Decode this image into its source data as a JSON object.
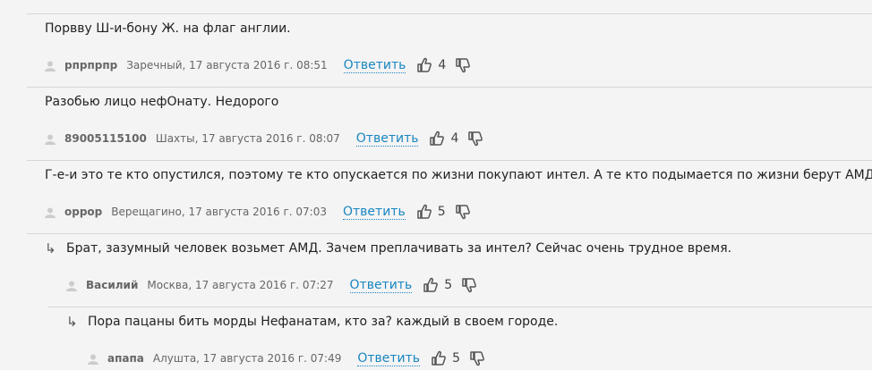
{
  "comments": [
    {
      "text": "Порвву Ш-и-бону Ж. на флаг англии.",
      "author": "рпрпрпр",
      "location_date": "Заречный, 17 августа 2016 г. 08:51",
      "reply_label": "Ответить",
      "score": "4"
    },
    {
      "text": "Разобью лицо нефОнату. Недорого",
      "author": "89005115100",
      "location_date": "Шахты, 17 августа 2016 г. 08:07",
      "reply_label": "Ответить",
      "score": "4"
    },
    {
      "text": "Г-е-и это те кто опустился, поэтому те кто опускается по жизни покупают интел. А те кто подымается по жизни берут АМД!",
      "author": "оррор",
      "location_date": "Верещагино, 17 августа 2016 г. 07:03",
      "reply_label": "Ответить",
      "score": "5"
    },
    {
      "reply_arrow": "↳",
      "text": "Брат, зазумный человек возьмет АМД. Зачем преплачивать за интел? Сейчас очень трудное время.",
      "author": "Василий",
      "location_date": "Москва, 17 августа 2016 г. 07:27",
      "reply_label": "Ответить",
      "score": "5"
    },
    {
      "reply_arrow": "↳",
      "text": "Пора пацаны бить морды Нефанатам, кто за? каждый в своем городе.",
      "author": "апапа",
      "location_date": "Алушта, 17 августа 2016 г. 07:49",
      "reply_label": "Ответить",
      "score": "5"
    }
  ],
  "colors": {
    "background": "#f4f4f4",
    "link": "#1a86c1",
    "meta_text": "#666666",
    "divider": "#d6d6d6"
  },
  "icons": {
    "user": "user-icon",
    "like": "thumb-up-icon",
    "dislike": "thumb-down-icon"
  }
}
